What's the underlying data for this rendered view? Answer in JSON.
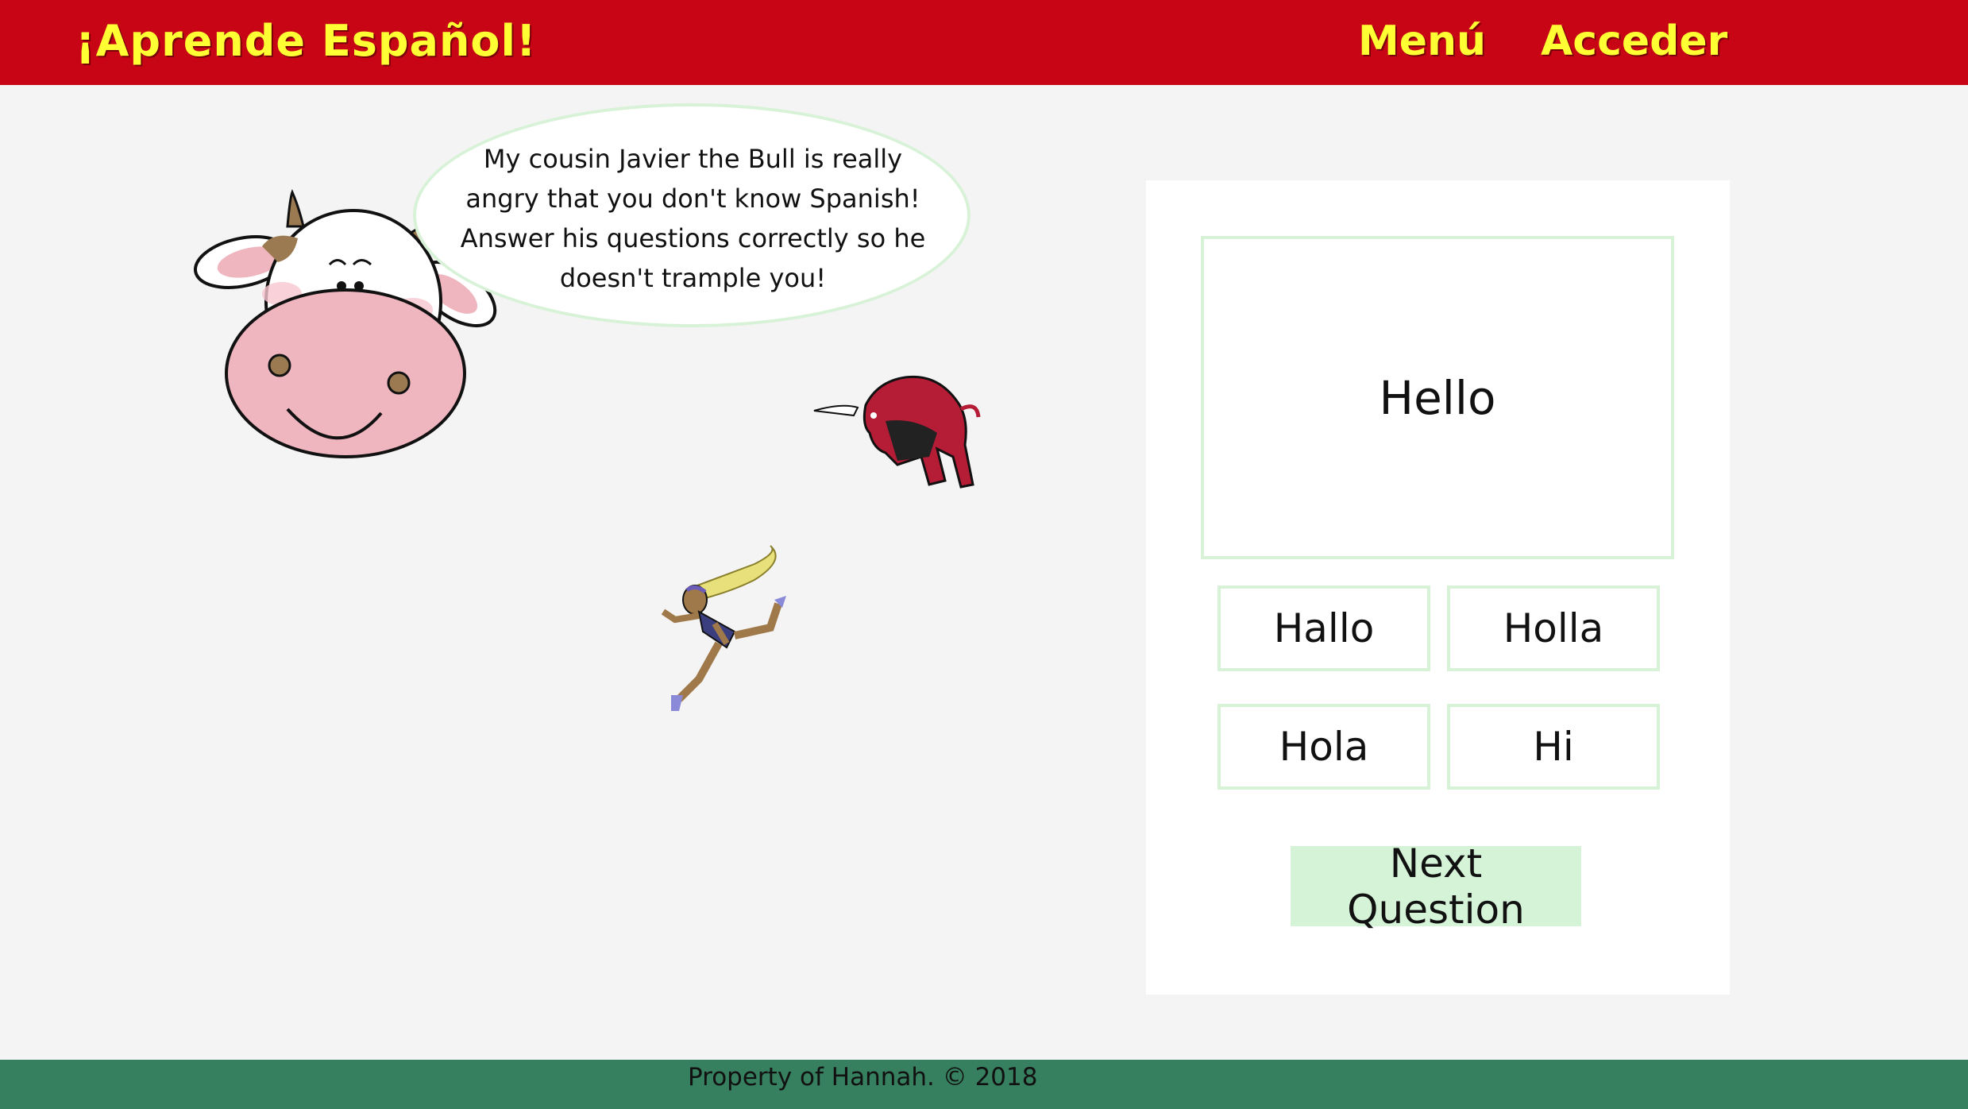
{
  "header": {
    "brand": "¡Aprende Español!",
    "nav": [
      "Menú",
      "Acceder"
    ]
  },
  "speech_bubble": {
    "text": "My cousin Javier the Bull is really angry that you don't know Spanish! Answer his questions correctly so he doesn't trample you!"
  },
  "illustrations": [
    "cow-mascot",
    "charging-bull",
    "running-woman"
  ],
  "quiz": {
    "prompt": "Hello",
    "answers": [
      "Hallo",
      "Holla",
      "Hola",
      "Hi"
    ],
    "next_label": "Next Question"
  },
  "footer": {
    "text": "Property of Hannah. © 2018"
  },
  "colors": {
    "header_bg": "#c70514",
    "brand_text": "#ffff33",
    "footer_bg": "#367f5f",
    "page_bg": "#f4f4f4",
    "accent_green": "#d5f3d7"
  }
}
